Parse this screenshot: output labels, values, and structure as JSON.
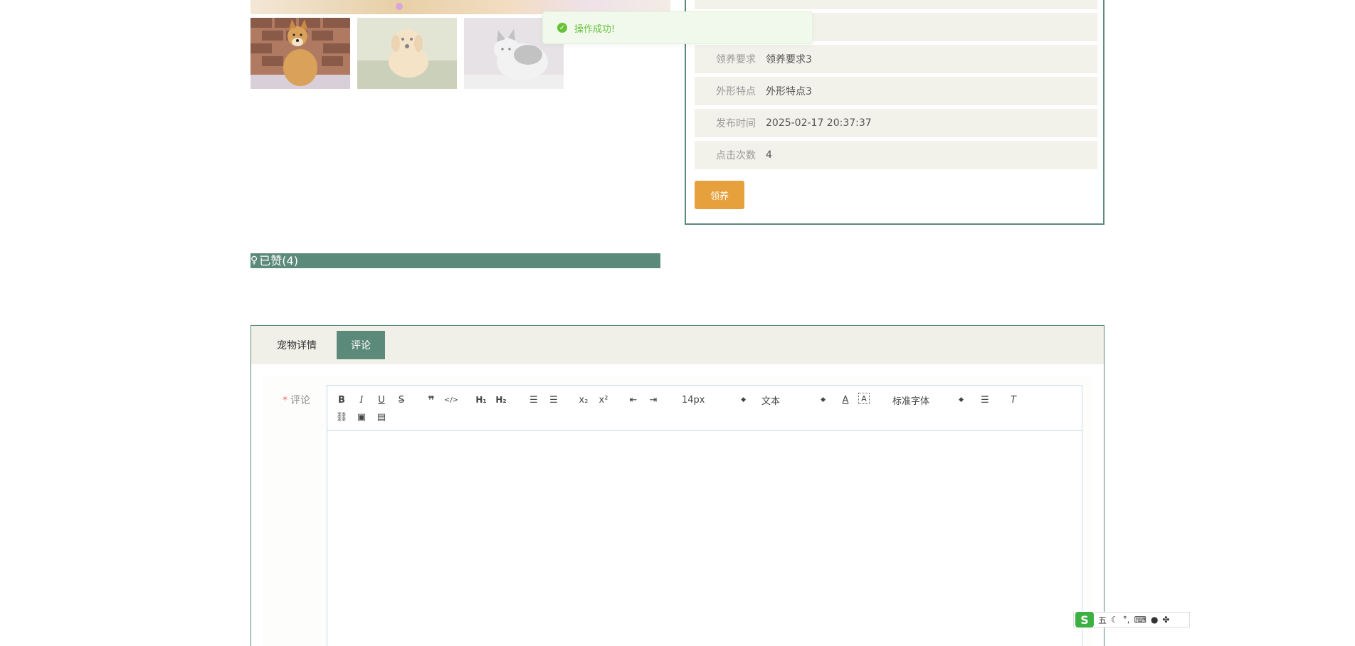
{
  "toast": {
    "message": "操作成功!",
    "icon": "check-circle-icon"
  },
  "pet_info": {
    "rows": [
      {
        "label": "",
        "value": ""
      },
      {
        "label": "领养要求",
        "value": "领养要求3"
      },
      {
        "label": "外形特点",
        "value": "外形特点3"
      },
      {
        "label": "发布时间",
        "value": "2025-02-17 20:37:37"
      },
      {
        "label": "点击次数",
        "value": "4"
      }
    ],
    "adopt_button": "领养"
  },
  "liked": {
    "icon": "like-icon",
    "label": "已赞(4)"
  },
  "tabs": [
    {
      "label": "宠物详情",
      "active": false
    },
    {
      "label": "评论",
      "active": true
    }
  ],
  "comment_form": {
    "required_mark": "*",
    "label": "评论",
    "font_size": "14px",
    "text_type": "文本",
    "font_family": "标准字体",
    "toolbar_icons": [
      "bold-icon",
      "italic-icon",
      "underline-icon",
      "strike-icon",
      "quote-icon",
      "code-icon",
      "h1-icon",
      "h2-icon",
      "ordered-list-icon",
      "bullet-list-icon",
      "subscript-icon",
      "superscript-icon",
      "outdent-icon",
      "indent-icon",
      "font-color-icon",
      "background-color-icon",
      "align-icon",
      "clear-format-icon",
      "link-icon",
      "image-icon",
      "video-icon"
    ]
  },
  "ime": {
    "mode": "五"
  },
  "colors": {
    "accent": "#5c8a7a",
    "adopt": "#e6a03c",
    "toast_text": "#67c23a",
    "row_bg": "#f2f1ea"
  }
}
